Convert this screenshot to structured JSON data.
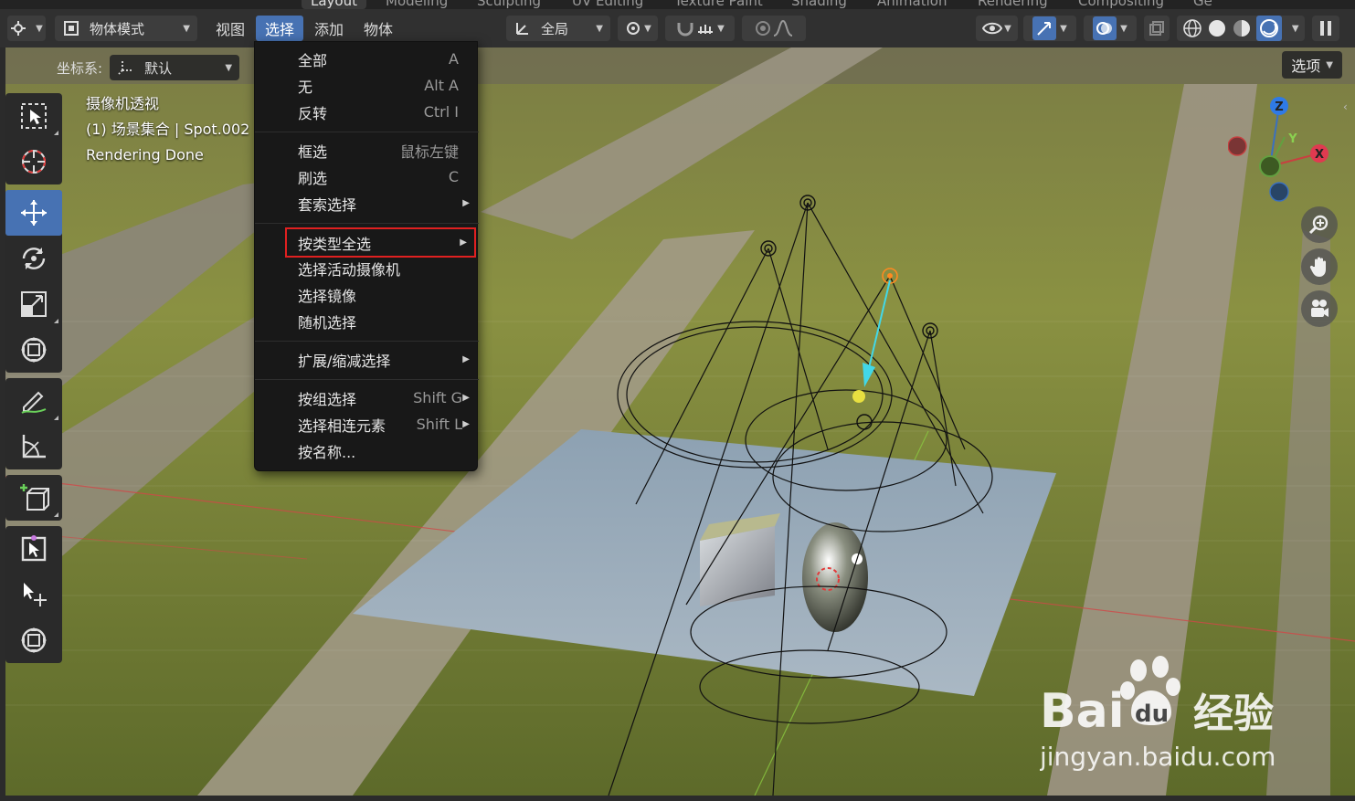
{
  "workspace_tabs": [
    "Layout",
    "Modeling",
    "Sculpting",
    "UV Editing",
    "Texture Paint",
    "Shading",
    "Animation",
    "Rendering",
    "Compositing",
    "Ge"
  ],
  "header": {
    "mode_label": "物体模式",
    "menus": {
      "view": "视图",
      "select": "选择",
      "add": "添加",
      "object": "物体"
    },
    "transform_orientation": "全局"
  },
  "viewport": {
    "coord_label": "坐标系:",
    "coord_value": "默认",
    "options_label": "选项",
    "info": {
      "view_name": "摄像机透视",
      "collection": "(1) 场景集合 | Spot.002",
      "status": "Rendering Done"
    },
    "gizmo": {
      "x": "X",
      "y": "Y",
      "z": "Z"
    }
  },
  "select_menu": {
    "items": [
      {
        "label": "全部",
        "shortcut": "A"
      },
      {
        "label": "无",
        "shortcut": "Alt A"
      },
      {
        "label": "反转",
        "shortcut": "Ctrl I"
      },
      {
        "label": "框选",
        "shortcut": "鼠标左键"
      },
      {
        "label": "刷选",
        "shortcut": "C"
      },
      {
        "label": "套索选择",
        "shortcut": ""
      },
      {
        "label": "按类型全选",
        "shortcut": ""
      },
      {
        "label": "选择活动摄像机",
        "shortcut": ""
      },
      {
        "label": "选择镜像",
        "shortcut": ""
      },
      {
        "label": "随机选择",
        "shortcut": ""
      },
      {
        "label": "扩展/缩减选择",
        "shortcut": ""
      },
      {
        "label": "按组选择",
        "shortcut": "Shift G"
      },
      {
        "label": "选择相连元素",
        "shortcut": "Shift L"
      },
      {
        "label": "按名称...",
        "shortcut": ""
      }
    ]
  },
  "watermark": {
    "brand": "Bai",
    "brand2": "du",
    "suffix": "经验",
    "url": "jingyan.baidu.com"
  },
  "colors": {
    "accent": "#4772b3",
    "menu_bg": "#181818",
    "highlight_border": "#e02020",
    "header_bg": "#303030"
  }
}
